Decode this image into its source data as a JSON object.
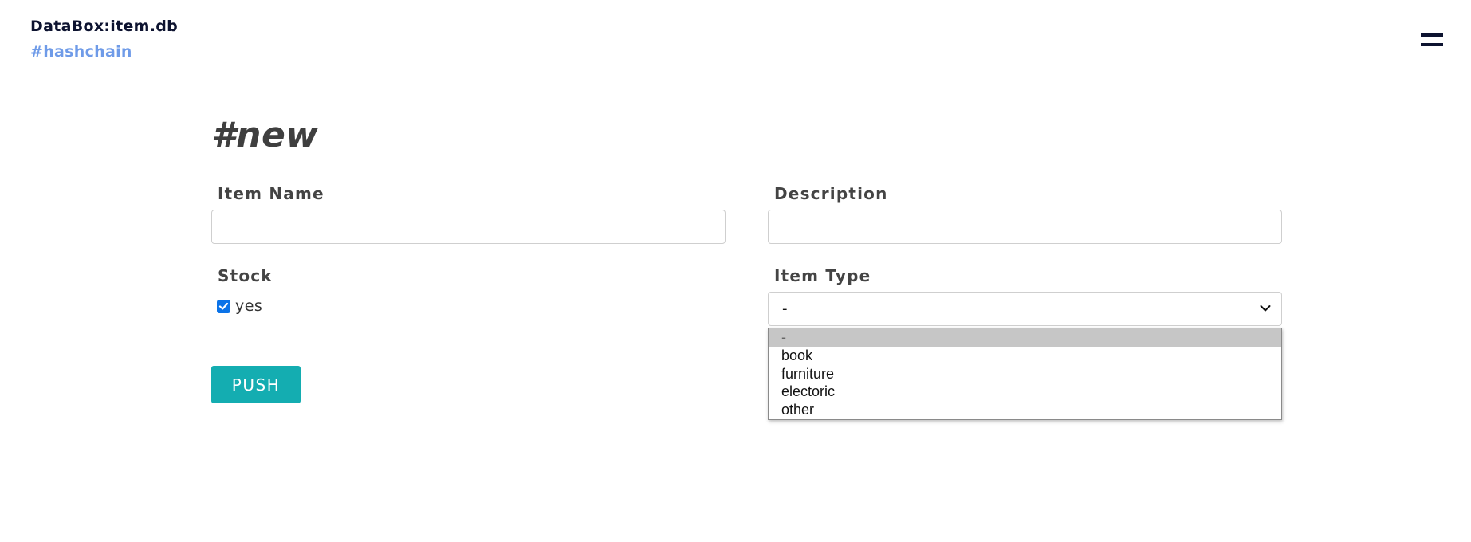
{
  "header": {
    "app_title": "DataBox:item.db",
    "subtitle_link": "#hashchain",
    "menu_icon": "hamburger-menu-icon"
  },
  "form": {
    "heading": "#new",
    "item_name": {
      "label": "Item Name",
      "value": "",
      "placeholder": ""
    },
    "description": {
      "label": "Description",
      "value": "",
      "placeholder": ""
    },
    "stock": {
      "label": "Stock",
      "checkbox_label": "yes",
      "checked": true
    },
    "item_type": {
      "label": "Item Type",
      "selected": "-",
      "options": [
        "-",
        "book",
        "furniture",
        "electoric",
        "other"
      ],
      "dropdown_open": true,
      "icon": "chevron-down-icon"
    },
    "submit_label": "PUSH"
  },
  "colors": {
    "title": "#0d1330",
    "link": "#6f9be8",
    "button_bg": "#14adb1",
    "checkbox": "#0b73e8",
    "option_highlight": "#c6c6c6"
  }
}
